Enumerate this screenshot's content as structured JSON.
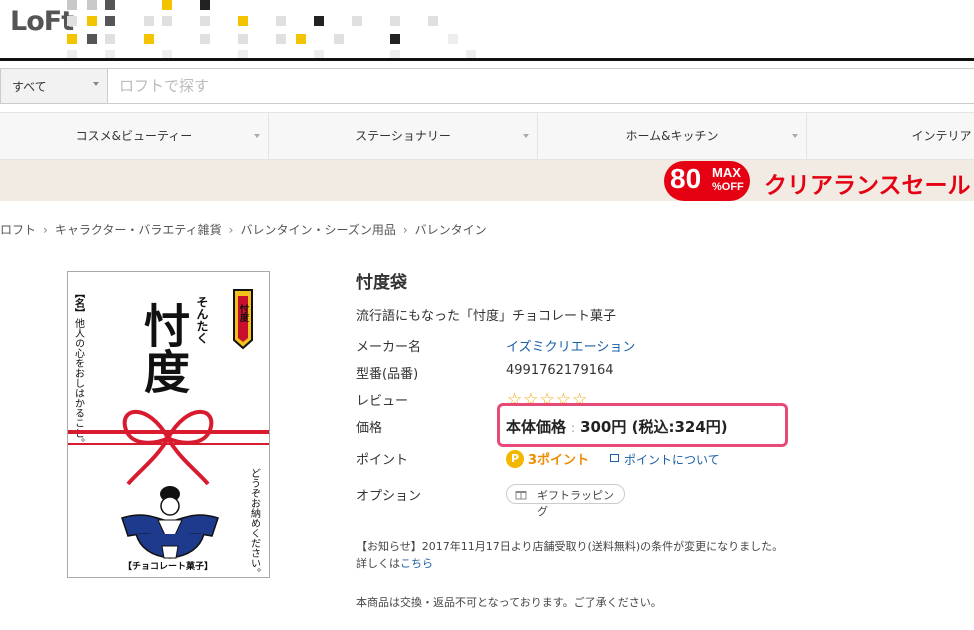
{
  "header": {
    "logo": "LoFt"
  },
  "search": {
    "scope": "すべて",
    "placeholder": "ロフトで探す"
  },
  "nav": {
    "categories": [
      "コスメ&ビューティー",
      "ステーショナリー",
      "ホーム&キッチン",
      "インテリア"
    ]
  },
  "banner": {
    "discount": "80",
    "max": "MAX",
    "off": "%OFF",
    "text": "クリアランスセール"
  },
  "breadcrumb": [
    "ロフト",
    "キャラクター・バラエティ雑貨",
    "バレンタイン・シーズン用品",
    "バレンタイン"
  ],
  "product": {
    "image_text": {
      "main": "忖度",
      "reading": "そんたく",
      "left_label": "【名】",
      "left_text": "他人の心をおしはかること。",
      "right_text": "どうぞお納めください。",
      "bottom": "【チョコレート菓子】",
      "seal": "忖度"
    },
    "title": "忖度袋",
    "subtitle": "流行語にもなった「忖度」チョコレート菓子",
    "maker_label": "メーカー名",
    "maker": "イズミクリエーション",
    "model_label": "型番(品番)",
    "model": "4991762179164",
    "review_label": "レビュー",
    "stars": "☆☆☆☆☆",
    "price_label": "価格",
    "price_prefix": "本体価格",
    "price_colon": ":",
    "price_value": "300円",
    "price_tax": "(税込:324円)",
    "point_label": "ポイント",
    "point_coin": "P",
    "points": "3ポイント",
    "point_link": "ポイントについて",
    "option_label": "オプション",
    "gift": "ギフトラッピング",
    "notice_line1": "【お知らせ】2017年11月17日より店舗受取り(送料無料)の条件が変更になりました。",
    "notice_prefix": "詳しくは",
    "notice_link": "こちら",
    "notice2": "本商品は交換・返品不可となっております。ご了承ください。"
  },
  "colors": {
    "brand_red": "#e50012",
    "highlight_pink": "#e84a77",
    "point_orange": "#f08c00",
    "link_blue": "#1a5fa8"
  }
}
